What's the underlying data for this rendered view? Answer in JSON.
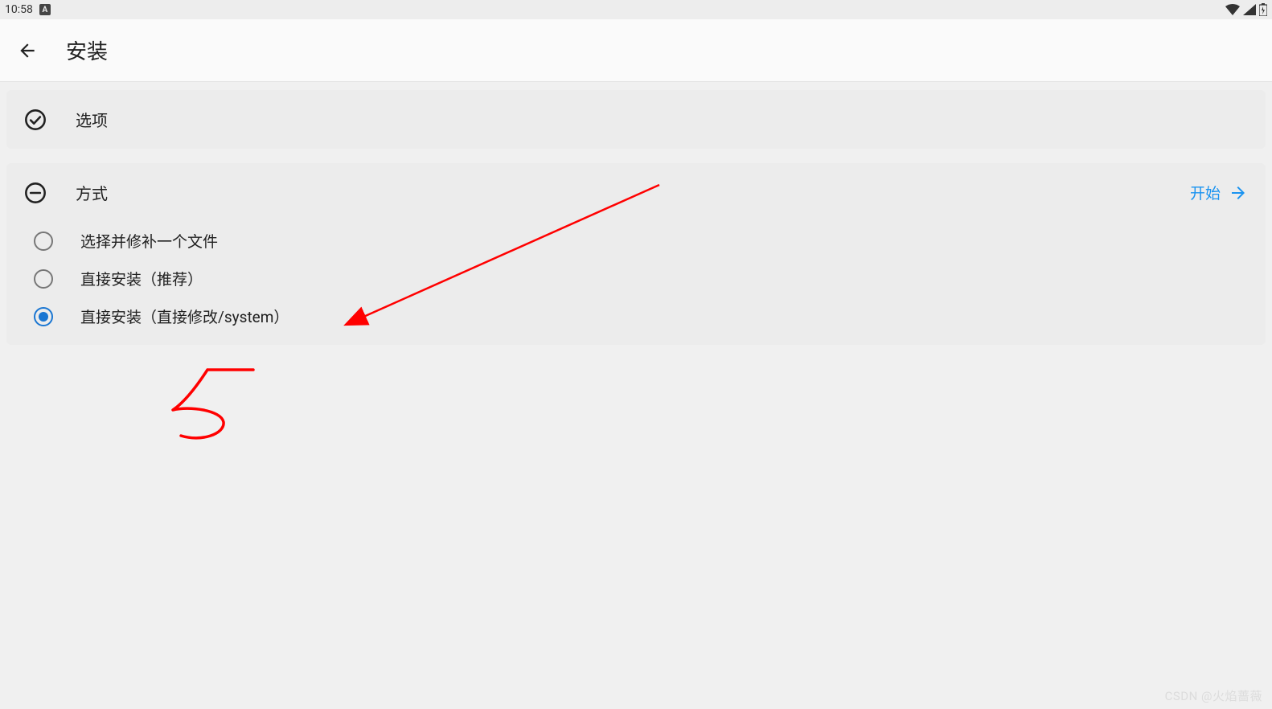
{
  "status": {
    "time": "10:58",
    "indicator_badge": "A"
  },
  "app_bar": {
    "title": "安装"
  },
  "options_card": {
    "title": "选项"
  },
  "method_card": {
    "title": "方式",
    "action_label": "开始",
    "options": [
      {
        "label": "选择并修补一个文件",
        "selected": false
      },
      {
        "label": "直接安装（推荐）",
        "selected": false
      },
      {
        "label": "直接安装（直接修改/system）",
        "selected": true
      }
    ]
  },
  "annotation": {
    "number": "5"
  },
  "watermark": "CSDN @火焰蔷薇",
  "colors": {
    "accent": "#1a93f0",
    "radio_selected": "#1a76d2",
    "annotation_red": "#ff0000"
  }
}
